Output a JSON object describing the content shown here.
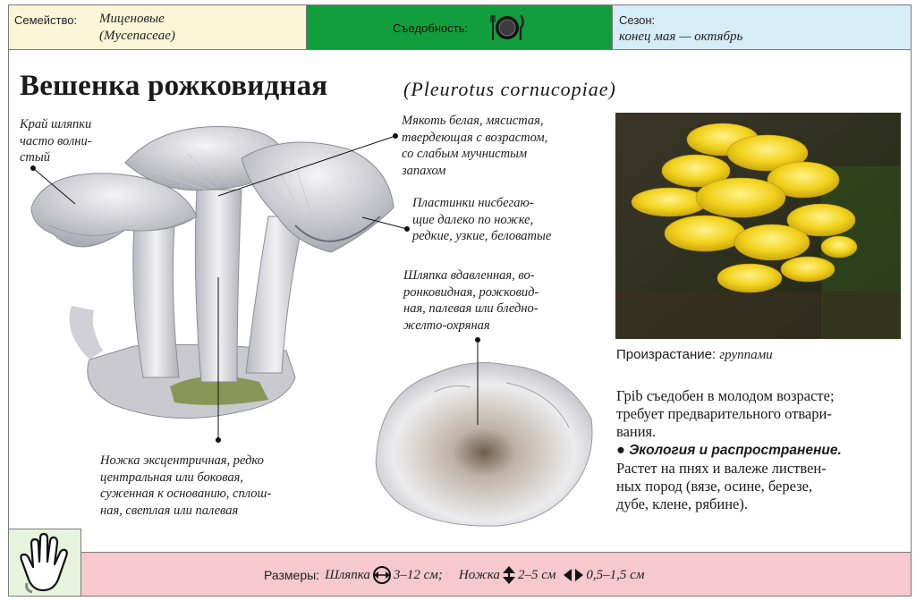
{
  "header": {
    "family_label": "Семейство:",
    "family_name": "Миценовые",
    "family_latin": "(Mycenaceae)",
    "edibility_label": "Съедобность:",
    "edibility_icon": "plate-fork-knife-icon",
    "season_label": "Сезон:",
    "season_value": "конец мая — октябрь"
  },
  "title": {
    "name": "Вешенка рожковидная",
    "latin": "(Pleurotus cornucopiae)"
  },
  "annotations": {
    "cap_edge": [
      "Край шляпки",
      "часто волни-",
      "стый"
    ],
    "flesh": [
      "Мякоть белая, мясистая,",
      "твердеющая с возрастом,",
      "со слабым мучнистым",
      "запахом"
    ],
    "gills": [
      "Пластинки нисбегаю-",
      "щие далеко по ножке,",
      "редкие, узкие, беловатые"
    ],
    "cap": [
      "Шляпка вдавленная, во-",
      "ронковидная, рожковид-",
      "ная, палевая или бледно-",
      "желто-охряная"
    ],
    "stem": [
      "Ножка эксцентричная, редко",
      "центральная или боковая,",
      "суженная к основанию, сплош-",
      "ная, светлая или палевая"
    ]
  },
  "habitat": {
    "label": "Произрастание:",
    "value": "группами"
  },
  "description": {
    "edibility_lines": [
      "Грib съедобен в молодом возрасте;",
      "требует предварительного отвари-",
      "вания."
    ],
    "ecology_heading": "Экология и распространение.",
    "ecology_lines": [
      "Растет на пнях и валеже листвен-",
      "ных пород (вязе, осине, березе,",
      "дубе, клене, рябине)."
    ]
  },
  "footer": {
    "hand_icon": "hand-icon",
    "sizes_label": "Размеры:",
    "cap_label": "Шляпка",
    "cap_value": "3–12 см;",
    "stem_label": "Ножка",
    "stem_length": "2–5 см",
    "stem_width": "0,5–1,5 см"
  },
  "colors": {
    "family_bg": "#fbf6d8",
    "edibility_bg": "#129e3c",
    "season_bg": "#d6ecf7",
    "footer_bg": "#f6c9cf",
    "hand_bg": "#e8f3de",
    "mushroom_photo": "#f2d21c"
  }
}
